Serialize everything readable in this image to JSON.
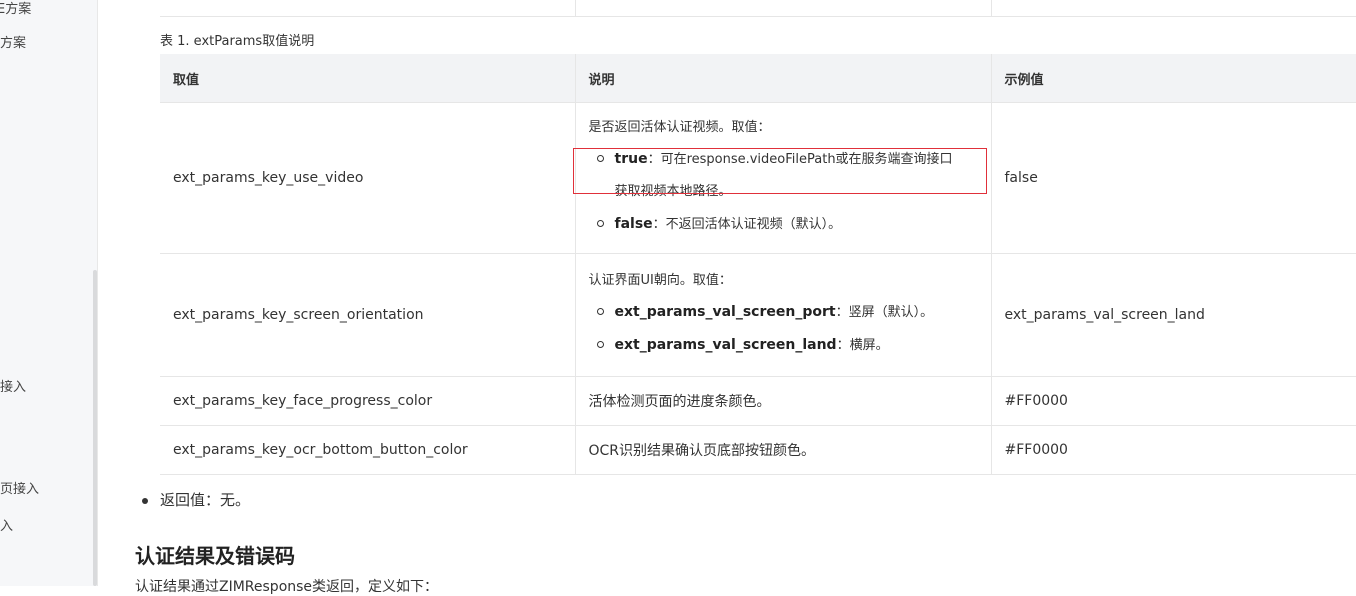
{
  "sidebar": {
    "items": [
      {
        "label": "E方案"
      },
      {
        "label": "方案"
      },
      {
        "label": "接入"
      },
      {
        "label": "页接入"
      },
      {
        "label": "入"
      }
    ]
  },
  "table": {
    "caption": "表 1. extParams取值说明",
    "headers": [
      "取值",
      "说明",
      "示例值"
    ],
    "rows": [
      {
        "key": "ext_params_key_use_video",
        "desc_intro": "是否返回活体认证视频。取值：",
        "bullets": [
          {
            "kw": "true",
            "text": "：可在response.videoFilePath或在服务端查询接口",
            "text2": "获取视频本地路径。"
          },
          {
            "kw": "false",
            "text": "：不返回活体认证视频（默认）。"
          }
        ],
        "example": "false"
      },
      {
        "key": "ext_params_key_screen_orientation",
        "desc_intro": "认证界面UI朝向。取值：",
        "bullets": [
          {
            "kw": "ext_params_val_screen_port",
            "text": "：竖屏（默认）。"
          },
          {
            "kw": "ext_params_val_screen_land",
            "text": "：横屏。"
          }
        ],
        "example": "ext_params_val_screen_land"
      },
      {
        "key": "ext_params_key_face_progress_color",
        "desc": "活体检测页面的进度条颜色。",
        "example": "#FF0000"
      },
      {
        "key": "ext_params_key_ocr_bottom_button_color",
        "desc": "OCR识别结果确认页底部按钮颜色。",
        "example": "#FF0000"
      }
    ]
  },
  "return_value": "返回值：无。",
  "section_title": "认证结果及错误码",
  "section_intro": "认证结果通过ZIMResponse类返回，定义如下：",
  "colors": {
    "highlight_border": "#e0303a",
    "header_bg": "#f2f3f5"
  }
}
